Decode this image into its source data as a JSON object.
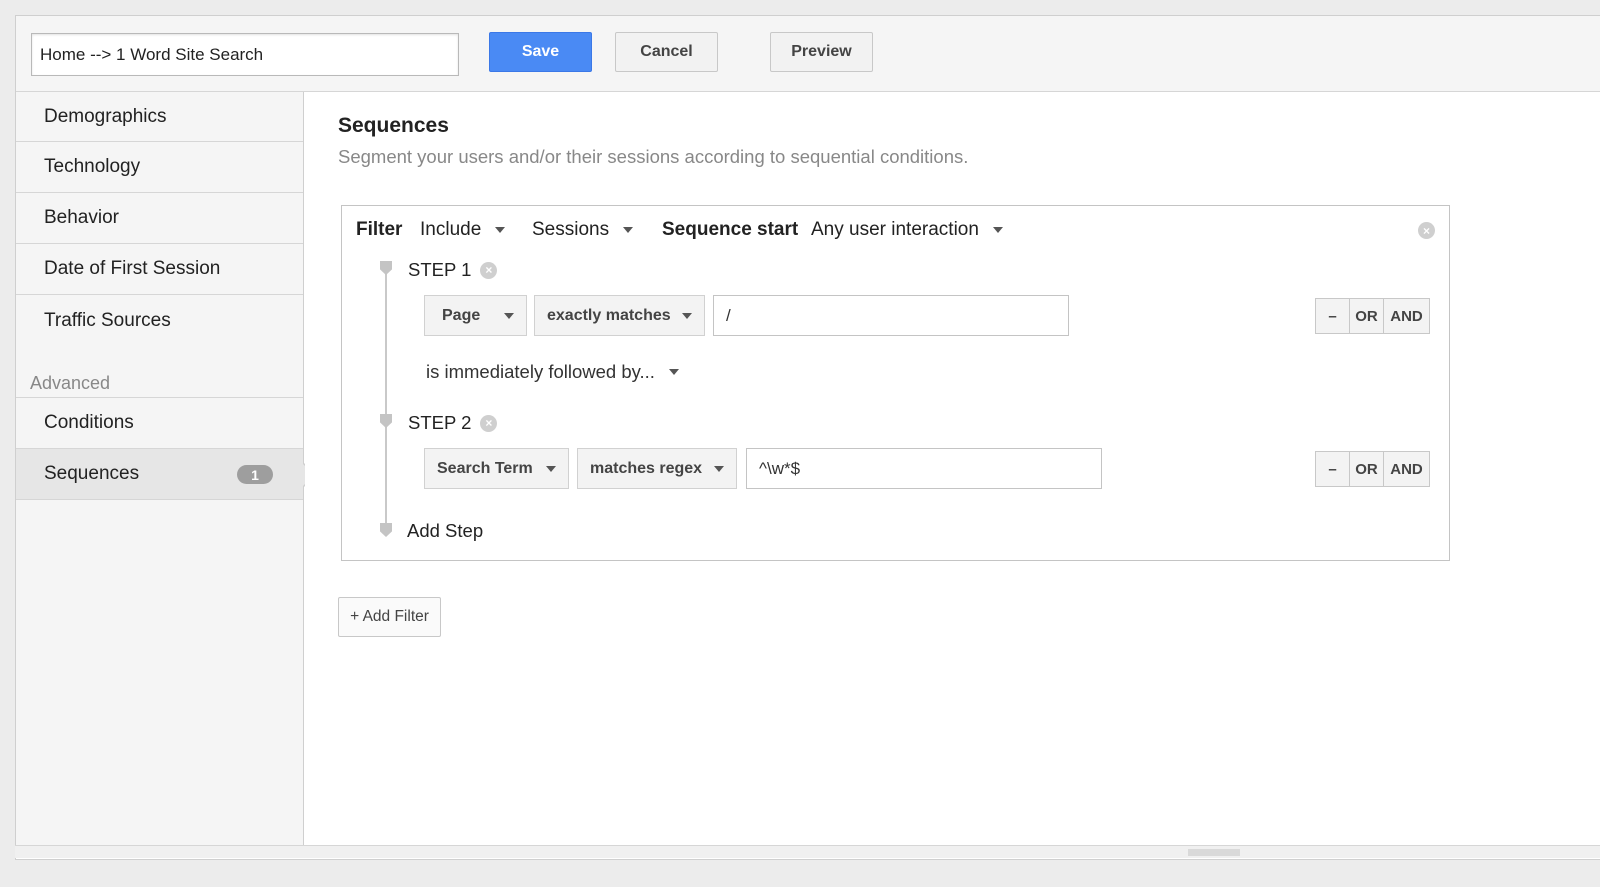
{
  "toolbar": {
    "segment_name": "Home --> 1 Word Site Search",
    "save_label": "Save",
    "cancel_label": "Cancel",
    "preview_label": "Preview"
  },
  "sidebar": {
    "items": [
      {
        "label": "Demographics"
      },
      {
        "label": "Technology"
      },
      {
        "label": "Behavior"
      },
      {
        "label": "Date of First Session"
      },
      {
        "label": "Traffic Sources"
      }
    ],
    "advanced_heading": "Advanced",
    "advanced_items": [
      {
        "label": "Conditions"
      },
      {
        "label": "Sequences",
        "badge": "1"
      }
    ]
  },
  "main": {
    "title": "Sequences",
    "subtitle": "Segment your users and/or their sessions according to sequential conditions.",
    "filter": {
      "filter_label": "Filter",
      "include_value": "Include",
      "scope_value": "Sessions",
      "sequence_start_label": "Sequence start",
      "sequence_start_value": "Any user interaction",
      "close_glyph": "×"
    },
    "steps": [
      {
        "label": "STEP 1",
        "dimension": "Page",
        "operator": "exactly matches",
        "value": "/",
        "minus": "–",
        "or": "OR",
        "and": "AND"
      },
      {
        "label": "STEP 2",
        "dimension": "Search Term",
        "operator": "matches regex",
        "value": "^\\w*$",
        "minus": "–",
        "or": "OR",
        "and": "AND"
      }
    ],
    "followed_by": "is immediately followed by...",
    "add_step": "Add Step",
    "add_filter": "+ Add Filter"
  },
  "colors": {
    "accent": "#4a8af4",
    "badge": "#9e9e9e"
  }
}
